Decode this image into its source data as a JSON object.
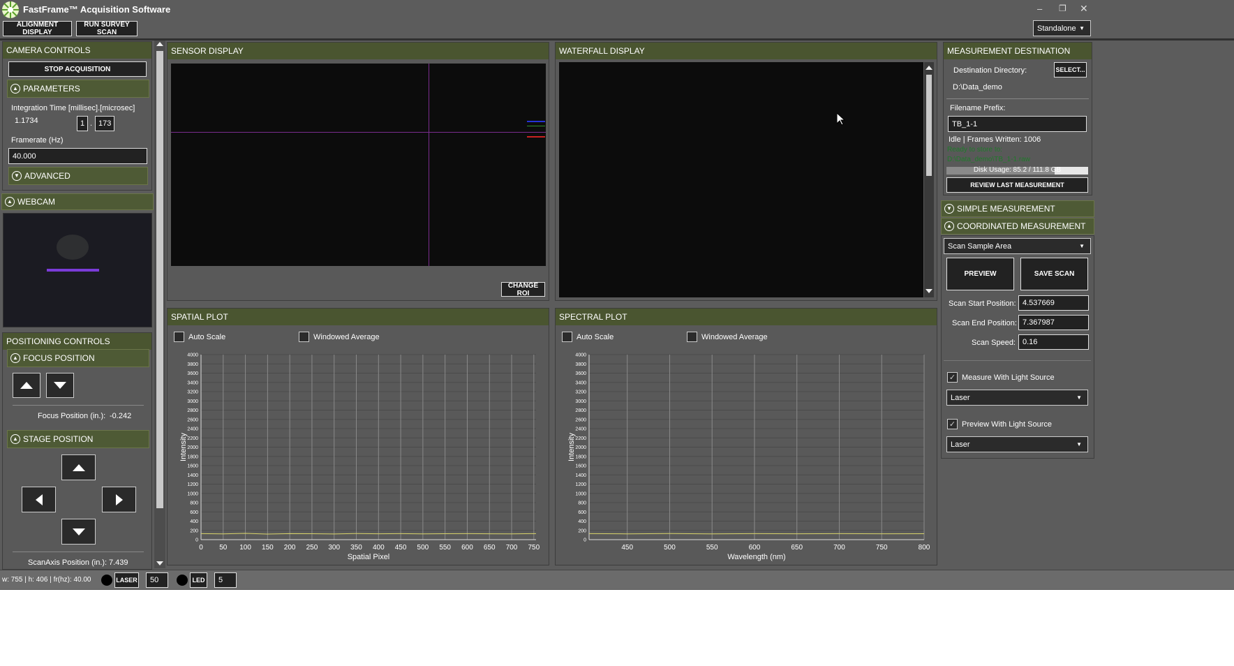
{
  "app": {
    "title": "FastFrame™ Acquisition Software"
  },
  "window_controls": {
    "minimize": "–",
    "restore": "❐",
    "close": "✕"
  },
  "toolbar": {
    "alignment_display": "ALIGNMENT DISPLAY",
    "run_survey_scan": "RUN SURVEY SCAN",
    "mode_select": "Standalone"
  },
  "camera_controls": {
    "title": "CAMERA CONTROLS",
    "stop_acquisition": "STOP ACQUISITION",
    "parameters": "PARAMETERS",
    "integration_label": "Integration Time [millisec].[microsec]",
    "integration_value": "1.1734",
    "integration_ms": "1",
    "integration_sep": ".",
    "integration_us": "173",
    "framerate_label": "Framerate (Hz)",
    "framerate_value": "40.000",
    "advanced": "ADVANCED"
  },
  "webcam": {
    "title": "WEBCAM"
  },
  "positioning": {
    "title": "POSITIONING CONTROLS",
    "focus_title": "FOCUS POSITION",
    "focus_label": "Focus Position (in.):",
    "focus_value": "-0.242",
    "stage_title": "STAGE POSITION",
    "scan_axis_label": "ScanAxis Position (in.):",
    "scan_axis_value": "7.439"
  },
  "sensor_display": {
    "title": "SENSOR DISPLAY",
    "change_roi": "CHANGE ROI"
  },
  "waterfall_display": {
    "title": "WATERFALL DISPLAY"
  },
  "measurement_destination": {
    "title": "MEASUREMENT DESTINATION",
    "dest_label": "Destination Directory:",
    "select_button": "SELECT...",
    "dest_value": "D:\\Data_demo",
    "prefix_label": "Filename Prefix:",
    "prefix_value": "TB_1-1",
    "status": "Idle | Frames Written: 1006",
    "ready_line1": "Ready to store to:",
    "ready_line2": "D:\\Data_demo\\TB_1-1.raw",
    "disk_usage": "Disk Usage: 85.2 / 111.8 GB",
    "disk_fraction": 0.762,
    "review_button": "REVIEW LAST MEASUREMENT"
  },
  "simple_measurement": {
    "title": "SIMPLE MEASUREMENT"
  },
  "coordinated_measurement": {
    "title": "COORDINATED MEASUREMENT",
    "scan_select": "Scan Sample Area",
    "preview_button": "PREVIEW",
    "save_scan_button": "SAVE SCAN",
    "start_label": "Scan Start Position:",
    "start_value": "4.537669",
    "end_label": "Scan End Position:",
    "end_value": "7.367987",
    "speed_label": "Scan Speed:",
    "speed_value": "0.16",
    "measure_light_label": "Measure With Light Source",
    "measure_light_select": "Laser",
    "preview_light_label": "Preview With Light Source",
    "preview_light_select": "Laser"
  },
  "status_bar": {
    "info": "w: 755 | h: 406 | fr(hz): 40.00",
    "laser_label": "LASER",
    "laser_value": "50",
    "led_label": "LED",
    "led_value": "5"
  },
  "spatial_plot": {
    "title": "SPATIAL PLOT",
    "auto_scale": "Auto Scale",
    "windowed_average": "Windowed Average"
  },
  "spectral_plot": {
    "title": "SPECTRAL PLOT",
    "auto_scale": "Auto Scale",
    "windowed_average": "Windowed Average"
  },
  "chart_data": [
    {
      "type": "line",
      "xlabel": "Spatial Pixel",
      "ylabel": "Intensity",
      "xlim": [
        0,
        755
      ],
      "ylim": [
        0,
        4000
      ],
      "xticks": [
        0,
        50,
        100,
        150,
        200,
        250,
        300,
        350,
        400,
        450,
        500,
        550,
        600,
        650,
        700,
        750
      ],
      "yticks": [
        0,
        200,
        400,
        600,
        800,
        1000,
        1200,
        1400,
        1600,
        1800,
        2000,
        2200,
        2400,
        2600,
        2800,
        3000,
        3200,
        3400,
        3600,
        3800,
        4000
      ],
      "grid": true,
      "series": [
        {
          "x": [
            0,
            50,
            100,
            150,
            200,
            250,
            300,
            350,
            400,
            450,
            500,
            550,
            600,
            650,
            700,
            755
          ],
          "y": [
            130,
            125,
            135,
            120,
            130,
            128,
            122,
            132,
            126,
            130,
            124,
            128,
            131,
            127,
            125,
            130
          ]
        }
      ]
    },
    {
      "type": "line",
      "xlabel": "Wavelength (nm)",
      "ylabel": "Intensity",
      "xlim": [
        405,
        800
      ],
      "ylim": [
        0,
        4000
      ],
      "xticks": [
        450,
        500,
        550,
        600,
        650,
        700,
        750,
        800
      ],
      "yticks": [
        0,
        200,
        400,
        600,
        800,
        1000,
        1200,
        1400,
        1600,
        1800,
        2000,
        2200,
        2400,
        2600,
        2800,
        3000,
        3200,
        3400,
        3600,
        3800,
        4000
      ],
      "grid": true,
      "series": [
        {
          "x": [
            405,
            450,
            500,
            550,
            600,
            650,
            700,
            750,
            800
          ],
          "y": [
            130,
            125,
            132,
            124,
            130,
            127,
            131,
            126,
            129
          ]
        }
      ]
    }
  ]
}
